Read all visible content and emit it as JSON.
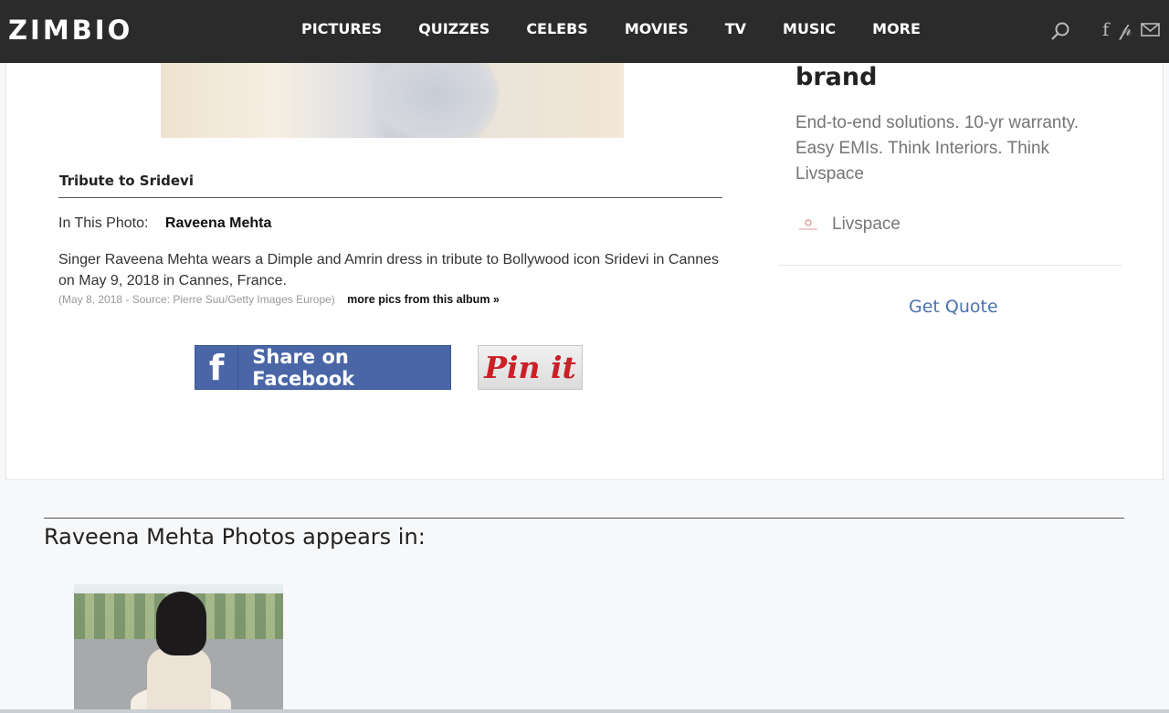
{
  "header": {
    "logo": "ZIMBIO",
    "nav": [
      "PICTURES",
      "QUIZZES",
      "CELEBS",
      "MOVIES",
      "TV",
      "MUSIC",
      "MORE"
    ],
    "icons": [
      "search-icon",
      "facebook-icon",
      "pinterest-icon",
      "mail-icon"
    ]
  },
  "photo": {
    "caption_title": "Tribute to Sridevi",
    "in_photo_label": "In This Photo:",
    "in_photo_name": "Raveena Mehta",
    "description": "Singer Raveena Mehta wears a Dimple and Amrin dress in tribute to Bollywood icon Sridevi in Cannes on May 9, 2018 in Cannes, France.",
    "meta": "(May 8, 2018 - Source: Pierre Suu/Getty Images Europe)",
    "more_link": "more pics from this album »"
  },
  "share": {
    "facebook_glyph": "f",
    "facebook_label": "Share on Facebook",
    "pin_label": "Pin it",
    "facebook_color": "#4a66a6",
    "pin_color": "#cb2027"
  },
  "ad": {
    "brand": "brand",
    "text": "End-to-end solutions. 10-yr warranty. Easy EMIs. Think Interiors. Think Livspace",
    "source": "Livspace",
    "cta": "Get Quote",
    "cta_color": "#4a73b0"
  },
  "appears_in": {
    "title": "Raveena Mehta Photos appears in:"
  }
}
